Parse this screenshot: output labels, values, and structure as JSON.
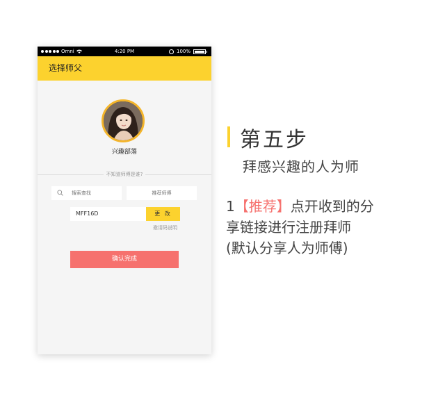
{
  "status_bar": {
    "carrier": "Omni",
    "time": "4:20 PM",
    "battery": "100%"
  },
  "nav": {
    "title": "选择师父"
  },
  "profile": {
    "name": "兴趣部落"
  },
  "divider": {
    "text": "不知道师傅是谁?"
  },
  "search": {
    "placeholder": "搜索查找"
  },
  "recommend": {
    "label": "推荐师傅"
  },
  "invite": {
    "code": "MFF16D",
    "change_label": "更 改",
    "help_label": "邀请码说明"
  },
  "confirm": {
    "label": "确认完成"
  },
  "instructions": {
    "title": "第五步",
    "subtitle": "拜感兴趣的人为师",
    "number": "1",
    "highlight": "【推荐】",
    "line1_rest": "点开收到的分",
    "line2": "享链接进行注册拜师",
    "line3": "(默认分享人为师傅)"
  },
  "colors": {
    "accent_yellow": "#fcd22e",
    "avatar_border": "#f4b52b",
    "confirm_red": "#f6716e"
  }
}
